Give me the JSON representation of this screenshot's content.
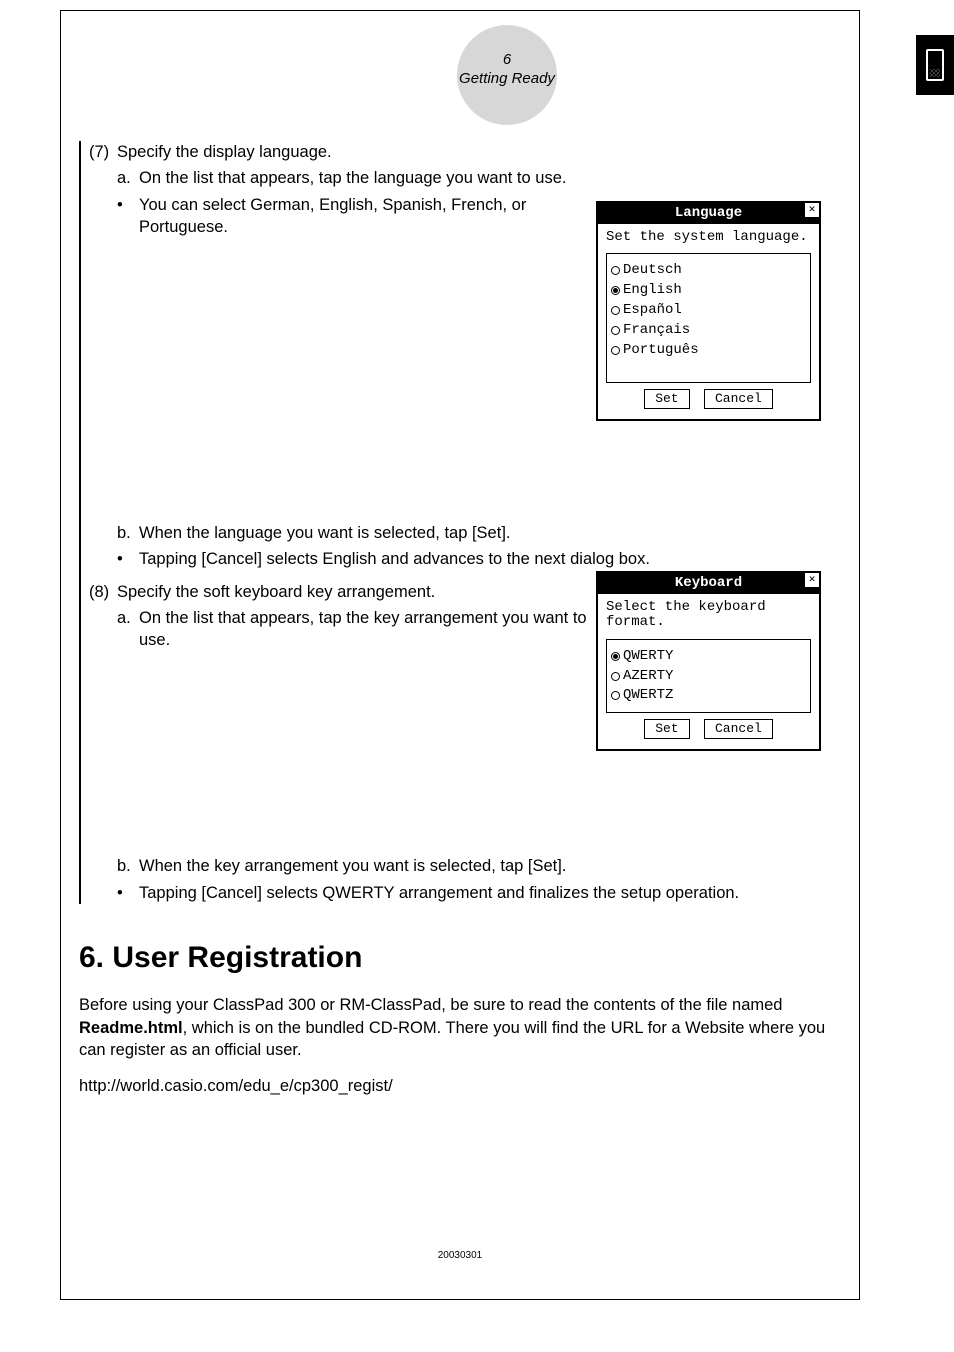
{
  "header": {
    "page_num": "6",
    "section": "Getting Ready"
  },
  "step7": {
    "num": "(7)",
    "title": "Specify the display language.",
    "a": {
      "mark": "a.",
      "text": "On the list that appears, tap the language you want to use."
    },
    "bullet1": "You can select German, English, Spanish, French, or Portuguese.",
    "b": {
      "mark": "b.",
      "text": "When the language you want is selected, tap [Set]."
    },
    "bullet2": "Tapping [Cancel] selects English and advances to the next dialog box."
  },
  "step8": {
    "num": "(8)",
    "title": "Specify the soft keyboard key arrangement.",
    "a": {
      "mark": "a.",
      "text": "On the list that appears, tap the key arrangement you want to use."
    },
    "b": {
      "mark": "b.",
      "text": "When the key arrangement you want is selected, tap [Set]."
    },
    "bullet1": "Tapping [Cancel] selects QWERTY arrangement and finalizes the setup operation."
  },
  "dialog_language": {
    "title": "Language",
    "prompt": "Set the system language.",
    "options": [
      "Deutsch",
      "English",
      "Español",
      "Français",
      "Português"
    ],
    "selected": "English",
    "set": "Set",
    "cancel": "Cancel"
  },
  "dialog_keyboard": {
    "title": "Keyboard",
    "prompt": "Select the keyboard format.",
    "options": [
      "QWERTY",
      "AZERTY",
      "QWERTZ"
    ],
    "selected": "QWERTY",
    "set": "Set",
    "cancel": "Cancel"
  },
  "registration": {
    "heading": "6. User Registration",
    "para_before": "Before using your ClassPad 300 or RM-ClassPad, be sure to read the contents of the file named ",
    "bold": "Readme.html",
    "para_after": ", which is on the bundled CD-ROM. There you will find the URL for a Website where you can register as an official user.",
    "url": "http://world.casio.com/edu_e/cp300_regist/"
  },
  "footer": "20030301"
}
